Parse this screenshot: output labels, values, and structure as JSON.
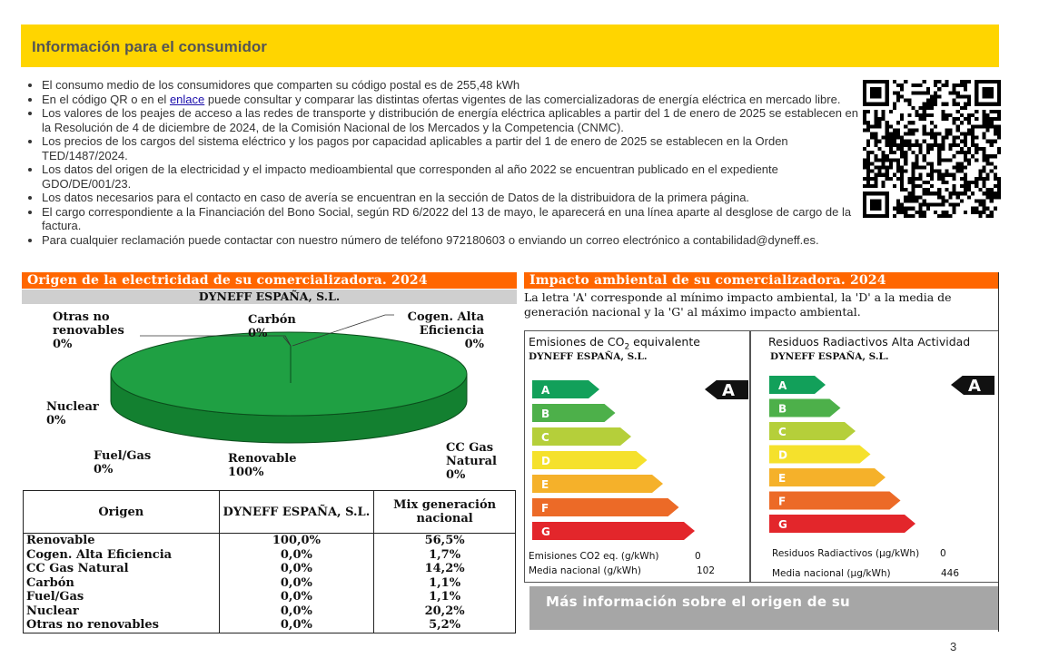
{
  "header": {
    "title": "Información para el consumidor"
  },
  "bullets": [
    "El consumo medio de los consumidores que comparten su código postal es de 255,48 kWh",
    "puede consultar y comparar las distintas ofertas vigentes de las comercializadoras de energía eléctrica en mercado libre.",
    "Los valores de los peajes de acceso a las redes de transporte y distribución de energía eléctrica aplicables a partir del 1 de enero de 2025 se establecen en la Resolución de 4 de diciembre de 2024, de la Comisión Nacional de los Mercados y la Competencia (CNMC).",
    "Los precios de los cargos del sistema eléctrico y los pagos por capacidad aplicables a partir del 1 de enero de 2025 se establecen en la Orden TED/1487/2024.",
    "Los datos del origen de la electricidad y el impacto medioambiental que corresponden al año 2022 se encuentran publicado en el expediente GDO/DE/001/23.",
    "Los datos necesarios para el contacto en caso de avería se encuentran en la sección de Datos de la distribuidora de la primera página.",
    "El cargo correspondiente a la Financiación del Bono Social, según RD 6/2022 del 13 de mayo, le aparecerá en una línea aparte al desglose de cargo de la factura.",
    "Para cualquier reclamación puede contactar con nuestro número de teléfono 972180603 o enviando un correo electrónico a contabilidad@dyneff.es."
  ],
  "bullet2_prefix": "En el código QR o en el",
  "bullet2_link": "enlace",
  "origin": {
    "title": "Origen de la electricidad de su comercializadora. 2024",
    "company": "DYNEFF ESPAÑA, S.L.",
    "pie_labels": {
      "otras": "Otras no\nrenovables\n0%",
      "carbon": "Carbón\n0%",
      "cogen": "Cogen. Alta\nEficiencia\n0%",
      "nuclear": "Nuclear\n0%",
      "fuel": "Fuel/Gas\n0%",
      "renovable": "Renovable\n100%",
      "ccgas": "CC Gas\nNatural\n0%"
    },
    "pie_color": "#1FA043",
    "table": {
      "headers": [
        "Origen",
        "DYNEFF ESPAÑA, S.L.",
        "Mix generación nacional"
      ],
      "rows": [
        [
          "Renovable",
          "100,0%",
          "56,5%"
        ],
        [
          "Cogen. Alta Eficiencia",
          "0,0%",
          "1,7%"
        ],
        [
          "CC Gas Natural",
          "0,0%",
          "14,2%"
        ],
        [
          "Carbón",
          "0,0%",
          "1,1%"
        ],
        [
          "Fuel/Gas",
          "0,0%",
          "1,1%"
        ],
        [
          "Nuclear",
          "0,0%",
          "20,2%"
        ],
        [
          "Otras no renovables",
          "0,0%",
          "5,2%"
        ]
      ]
    }
  },
  "impact": {
    "title": "Impacto ambiental de su comercializadora. 2024",
    "note": "La letra 'A' corresponde al mínimo impacto ambiental, la 'D' a la media de generación nacional y la 'G' al máximo impacto ambiental.",
    "rating_letters": [
      "A",
      "B",
      "C",
      "D",
      "E",
      "F",
      "G"
    ],
    "rating_colors": [
      "#12A05A",
      "#4DB04A",
      "#B5CF3A",
      "#F5E12C",
      "#F5B12A",
      "#EC6A27",
      "#E3262B"
    ],
    "co2": {
      "title_pre": "Emisiones de CO",
      "title_sub": "2",
      "title_post": " equivalente",
      "company": "DYNEFF ESPAÑA, S.L.",
      "rating": "A",
      "stat1_label": "Emisiones CO2 eq. (g/kWh)",
      "stat1_value": "0",
      "stat2_label": "Media nacional (g/kWh)",
      "stat2_value": "102"
    },
    "rad": {
      "title": "Residuos Radiactivos Alta Actividad",
      "company": "DYNEFF ESPAÑA, S.L.",
      "rating": "A",
      "stat1_label": "Residuos Radiactivos (µg/kWh)",
      "stat1_value": "0",
      "stat2_label": "Media nacional (µg/kWh)",
      "stat2_value": "446"
    }
  },
  "more_info": "Más información sobre el origen de su",
  "page_number": "3"
}
